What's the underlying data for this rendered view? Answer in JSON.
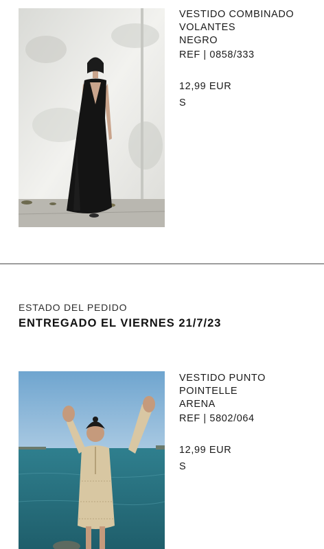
{
  "orders": [
    {
      "name": "VESTIDO COMBINADO\nVOLANTES\nNEGRO",
      "ref": "REF | 0858/333",
      "price": "12,99 EUR",
      "size": "S",
      "image": "black-maxi-dress-photo"
    }
  ],
  "status": {
    "label": "ESTADO DEL PEDIDO",
    "value": "ENTREGADO EL VIERNES 21/7/23"
  },
  "delivered_items": [
    {
      "name": "VESTIDO PUNTO\nPOINTELLE\nARENA",
      "ref": "REF | 5802/064",
      "price": "12,99 EUR",
      "size": "S",
      "image": "sand-crochet-dress-photo"
    }
  ]
}
